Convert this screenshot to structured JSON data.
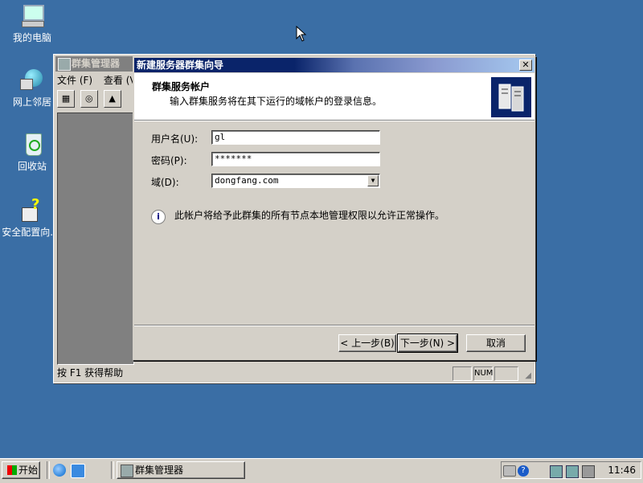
{
  "desktop": {
    "icons": [
      {
        "label": "我的电脑"
      },
      {
        "label": "网上邻居"
      },
      {
        "label": "回收站"
      },
      {
        "label": "安全配置向..."
      }
    ]
  },
  "cluadmin": {
    "title": "群集管理器",
    "menu": [
      "文件 (F)",
      "查看 (V"
    ],
    "status_text": "按 F1 获得帮助",
    "status_num": "NUM"
  },
  "wizard": {
    "title": "新建服务器群集向导",
    "close_label": "✕",
    "header_title": "群集服务帐户",
    "header_subtitle": "输入群集服务将在其下运行的域帐户的登录信息。",
    "fields": {
      "username_label": "用户名(U):",
      "username_value": "gl",
      "password_label": "密码(P):",
      "password_value": "*******",
      "domain_label": "域(D):",
      "domain_value": "dongfang.com"
    },
    "info_text": "此帐户将给予此群集的所有节点本地管理权限以允许正常操作。",
    "buttons": {
      "back": "< 上一步(B)",
      "next": "下一步(N) >",
      "cancel": "取消"
    }
  },
  "taskbar": {
    "start_label": "开始",
    "task_label": "群集管理器",
    "clock": "11:46"
  },
  "colors": {
    "desktop": "#3a6ea5",
    "title_active": "#0a246a",
    "face": "#d4d0c8"
  }
}
